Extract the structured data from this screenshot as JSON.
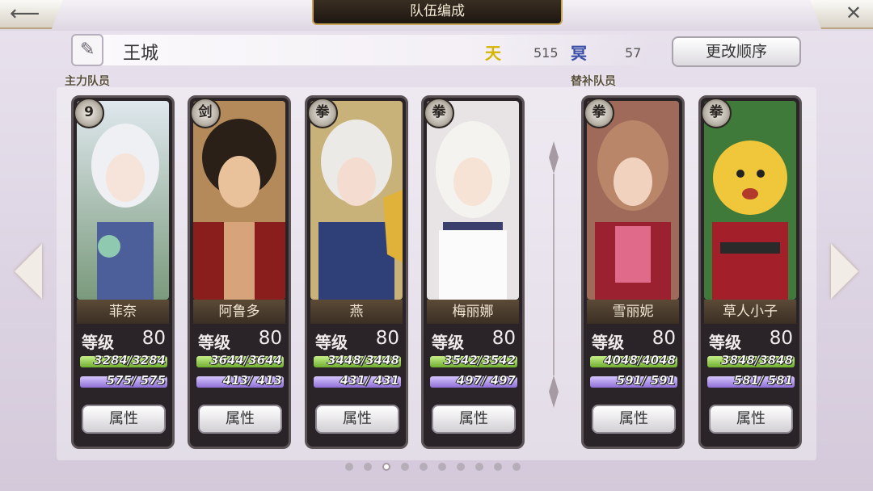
{
  "header": {
    "title": "队伍编成",
    "back_icon": "back-arrow-icon",
    "close_icon": "close-icon"
  },
  "party": {
    "name": "王城",
    "stat1_icon": "天",
    "stat1_value": "515",
    "stat2_icon": "冥",
    "stat2_value": "57",
    "reorder_label": "更改顺序"
  },
  "sections": {
    "main": "主力队员",
    "sub": "替补队员"
  },
  "labels": {
    "level": "等级",
    "attributes": "属性"
  },
  "members": [
    {
      "name": "菲奈",
      "role_icon": "9",
      "level": "80",
      "hp": "3284/3284",
      "sp": "575/ 575"
    },
    {
      "name": "阿鲁多",
      "role_icon": "剑",
      "level": "80",
      "hp": "3644/3644",
      "sp": "413/ 413"
    },
    {
      "name": "燕",
      "role_icon": "拳",
      "level": "80",
      "hp": "3448/3448",
      "sp": "431/ 431"
    },
    {
      "name": "梅丽娜",
      "role_icon": "拳",
      "level": "80",
      "hp": "3542/3542",
      "sp": "497/ 497"
    },
    {
      "name": "雪丽妮",
      "role_icon": "拳",
      "level": "80",
      "hp": "4048/4048",
      "sp": "591/ 591"
    },
    {
      "name": "草人小子",
      "role_icon": "拳",
      "level": "80",
      "hp": "3848/3848",
      "sp": "581/ 581"
    }
  ],
  "pagination": {
    "total": 10,
    "active": 3
  },
  "colors": {
    "hp_bar": "#8fcc4a",
    "sp_bar": "#a98ce8",
    "title_plate": "#2a2119"
  }
}
